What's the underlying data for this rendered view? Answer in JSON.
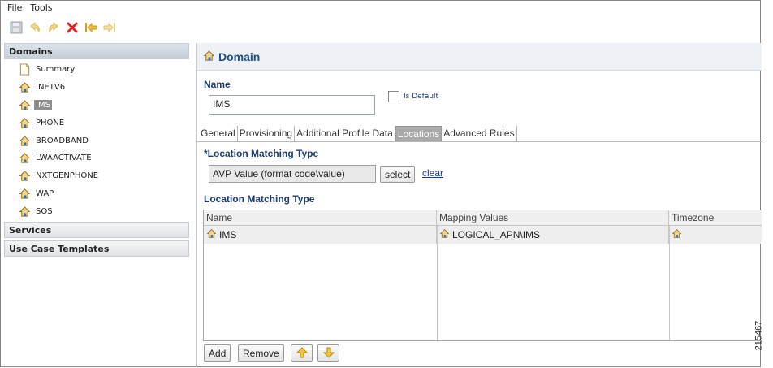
{
  "menu": [
    "File",
    "Tools"
  ],
  "toolbar": {
    "icons": [
      "save-icon",
      "undo-icon",
      "redo-icon",
      "delete-icon",
      "back-icon",
      "forward-icon"
    ]
  },
  "sidebar": {
    "domains_header": "Domains",
    "items": [
      {
        "label": "Summary",
        "icon": "document-icon"
      },
      {
        "label": "INETV6",
        "icon": "house-icon"
      },
      {
        "label": "IMS",
        "icon": "house-icon",
        "selected": true
      },
      {
        "label": "PHONE",
        "icon": "house-icon"
      },
      {
        "label": "BROADBAND",
        "icon": "house-icon"
      },
      {
        "label": "LWAACTIVATE",
        "icon": "house-icon"
      },
      {
        "label": "NXTGENPHONE",
        "icon": "house-icon"
      },
      {
        "label": "WAP",
        "icon": "house-icon"
      },
      {
        "label": "SOS",
        "icon": "house-icon"
      }
    ],
    "services_header": "Services",
    "use_case_header": "Use Case Templates"
  },
  "main": {
    "title": "Domain",
    "name_label": "Name",
    "name_value": "IMS",
    "is_default_label": "Is Default",
    "tabs": [
      {
        "label": "General"
      },
      {
        "label": "Provisioning"
      },
      {
        "label": "Additional Profile Data"
      },
      {
        "label": "Locations",
        "active": true
      },
      {
        "label": "Advanced Rules"
      }
    ],
    "lmt_label": "*Location Matching Type",
    "lmt_value": "AVP Value (format code\\value)",
    "select_label": "select",
    "clear_label": "clear",
    "lmt_table_label": "Location Matching Type",
    "table": {
      "headers": [
        "Name",
        "Mapping Values",
        "Timezone"
      ],
      "rows": [
        {
          "name": "IMS",
          "mapping": "LOGICAL_APN\\IMS",
          "timezone": ""
        }
      ]
    },
    "add_label": "Add",
    "remove_label": "Remove"
  },
  "figure_id": "215467",
  "colors": {
    "accent": "#1f4e86",
    "selected": "#8e8e8e",
    "tab_active": "#a9a9a9"
  }
}
